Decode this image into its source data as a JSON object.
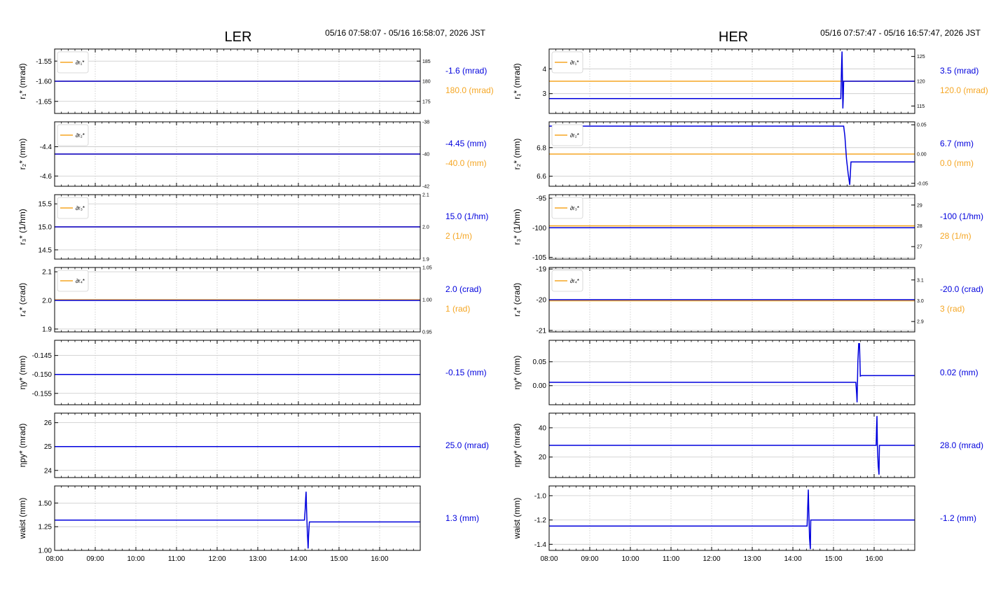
{
  "colors": {
    "current": "#0000dd",
    "target": "#f5a623",
    "grid": "#c8c8c8"
  },
  "chart_data": [
    {
      "type": "line",
      "title": "LER",
      "time_range": "05/16 07:58:07 - 05/16 16:58:07, 2026 JST",
      "x_ticks": [
        "08:00",
        "09:00",
        "10:00",
        "11:00",
        "12:00",
        "13:00",
        "14:00",
        "15:00",
        "16:00"
      ],
      "x_range_hours": [
        8.0,
        17.0
      ],
      "panels": [
        {
          "ylabel": "r₁* (mrad)",
          "ylim": [
            -1.68,
            -1.52
          ],
          "yticks": [
            "-1.55",
            "-1.60",
            "-1.65"
          ],
          "ytick_vals": [
            -1.55,
            -1.6,
            -1.65
          ],
          "y2lim": [
            172,
            188
          ],
          "y2ticks": [
            "185",
            "180",
            "175"
          ],
          "y2tick_vals": [
            185,
            180,
            175
          ],
          "legend": "∂r₁*",
          "current_label": "-1.6 (mrad)",
          "target_label": "180.0 (mrad)",
          "series": [
            {
              "name": "∂r₁*",
              "axis": "right",
              "color": "target",
              "x": [
                8.0,
                17.0
              ],
              "y": [
                180,
                180
              ]
            },
            {
              "axis": "left",
              "color": "current",
              "x": [
                8.0,
                17.0
              ],
              "y": [
                -1.6,
                -1.6
              ]
            }
          ]
        },
        {
          "ylabel": "r₂* (mm)",
          "ylim": [
            -4.67,
            -4.23
          ],
          "yticks": [
            "-4.4",
            "-4.6"
          ],
          "ytick_vals": [
            -4.4,
            -4.6
          ],
          "y2lim": [
            -42,
            -38
          ],
          "y2ticks": [
            "-38",
            "-40",
            "-42"
          ],
          "y2tick_vals": [
            -38,
            -40,
            -42
          ],
          "legend": "∂r₂*",
          "current_label": "-4.45 (mm)",
          "target_label": "-40.0 (mm)",
          "series": [
            {
              "name": "∂r₂*",
              "axis": "right",
              "color": "target",
              "x": [
                8.0,
                17.0
              ],
              "y": [
                -40,
                -40
              ]
            },
            {
              "axis": "left",
              "color": "current",
              "x": [
                8.0,
                17.0
              ],
              "y": [
                -4.45,
                -4.45
              ]
            }
          ]
        },
        {
          "ylabel": "r₃* (1/hm)",
          "ylim": [
            14.3,
            15.7
          ],
          "yticks": [
            "15.5",
            "15.0",
            "14.5"
          ],
          "ytick_vals": [
            15.5,
            15.0,
            14.5
          ],
          "y2lim": [
            1.9,
            2.1
          ],
          "y2ticks": [
            "2.1",
            "2.0",
            "1.9"
          ],
          "y2tick_vals": [
            2.1,
            2.0,
            1.9
          ],
          "legend": "∂r₃*",
          "current_label": "15.0 (1/hm)",
          "target_label": "2 (1/m)",
          "series": [
            {
              "name": "∂r₃*",
              "axis": "right",
              "color": "target",
              "x": [
                8.0,
                17.0
              ],
              "y": [
                2.0,
                2.0
              ]
            },
            {
              "axis": "left",
              "color": "current",
              "x": [
                8.0,
                17.0
              ],
              "y": [
                15.0,
                15.0
              ]
            }
          ]
        },
        {
          "ylabel": "r₄* (crad)",
          "ylim": [
            1.89,
            2.115
          ],
          "yticks": [
            "2.1",
            "2.0",
            "1.9"
          ],
          "ytick_vals": [
            2.1,
            2.0,
            1.9
          ],
          "y2lim": [
            0.95,
            1.05
          ],
          "y2ticks": [
            "1.05",
            "1.00",
            "0.95"
          ],
          "y2tick_vals": [
            1.05,
            1.0,
            0.95
          ],
          "legend": "∂r₄*",
          "current_label": "2.0 (crad)",
          "target_label": "1 (rad)",
          "series": [
            {
              "name": "∂r₄*",
              "axis": "right",
              "color": "target",
              "x": [
                8.0,
                17.0
              ],
              "y": [
                1.0,
                1.0
              ]
            },
            {
              "axis": "left",
              "color": "current",
              "x": [
                8.0,
                17.0
              ],
              "y": [
                2.0,
                2.0
              ]
            }
          ]
        },
        {
          "ylabel": "ηy* (mm)",
          "ylim": [
            -0.158,
            -0.141
          ],
          "yticks": [
            "-0.145",
            "-0.150",
            "-0.155"
          ],
          "ytick_vals": [
            -0.145,
            -0.15,
            -0.155
          ],
          "current_label": "-0.15 (mm)",
          "series": [
            {
              "axis": "left",
              "color": "current",
              "x": [
                8.0,
                17.0
              ],
              "y": [
                -0.15,
                -0.15
              ]
            }
          ]
        },
        {
          "ylabel": "ηpy* (mrad)",
          "ylim": [
            23.7,
            26.4
          ],
          "yticks": [
            "26",
            "25",
            "24"
          ],
          "ytick_vals": [
            26,
            25,
            24
          ],
          "current_label": "25.0 (mrad)",
          "series": [
            {
              "axis": "left",
              "color": "current",
              "x": [
                8.0,
                17.0
              ],
              "y": [
                25.0,
                25.0
              ]
            }
          ]
        },
        {
          "ylabel": "waist (mm)",
          "ylim": [
            1.0,
            1.68
          ],
          "yticks": [
            "1.50",
            "1.25",
            "1.00"
          ],
          "ytick_vals": [
            1.5,
            1.25,
            1.0
          ],
          "current_label": "1.3 (mm)",
          "series": [
            {
              "axis": "left",
              "color": "current",
              "x": [
                8.0,
                14.15,
                14.17,
                14.18,
                14.19,
                14.2,
                14.22,
                14.24,
                14.25,
                14.27,
                14.28,
                14.3,
                17.0
              ],
              "y": [
                1.32,
                1.32,
                1.45,
                1.55,
                1.62,
                1.45,
                1.2,
                1.02,
                1.15,
                1.3,
                1.3,
                1.3,
                1.3
              ]
            }
          ]
        }
      ]
    },
    {
      "type": "line",
      "title": "HER",
      "time_range": "05/16 07:57:47 - 05/16 16:57:47, 2026 JST",
      "x_ticks": [
        "08:00",
        "09:00",
        "10:00",
        "11:00",
        "12:00",
        "13:00",
        "14:00",
        "15:00",
        "16:00"
      ],
      "x_range_hours": [
        8.0,
        17.0
      ],
      "panels": [
        {
          "ylabel": "r₁* (mrad)",
          "ylim": [
            2.2,
            4.8
          ],
          "yticks": [
            "4",
            "3"
          ],
          "ytick_vals": [
            4,
            3
          ],
          "y2lim": [
            113.5,
            126.5
          ],
          "y2ticks": [
            "125",
            "120",
            "115"
          ],
          "y2tick_vals": [
            125,
            120,
            115
          ],
          "legend": "∂r₁*",
          "current_label": "3.5 (mrad)",
          "target_label": "120.0 (mrad)",
          "series": [
            {
              "name": "∂r₁*",
              "axis": "right",
              "color": "target",
              "x": [
                8.0,
                17.0
              ],
              "y": [
                120,
                120
              ]
            },
            {
              "axis": "left",
              "color": "current",
              "x": [
                8.0,
                15.18,
                15.19,
                15.2,
                15.21,
                15.22,
                15.23,
                15.24,
                15.25,
                15.26,
                17.0
              ],
              "y": [
                2.8,
                2.8,
                3.5,
                4.2,
                4.7,
                3.6,
                2.4,
                2.8,
                3.5,
                3.5,
                3.5
              ]
            }
          ]
        },
        {
          "ylabel": "r₂* (mm)",
          "ylim": [
            6.53,
            6.98
          ],
          "yticks": [
            "6.8",
            "6.6"
          ],
          "ytick_vals": [
            6.8,
            6.6
          ],
          "y2lim": [
            -0.055,
            0.055
          ],
          "y2ticks": [
            "0.05",
            "0.00",
            "-0.05"
          ],
          "y2tick_vals": [
            0.05,
            0.0,
            -0.05
          ],
          "legend": "∂r₂*",
          "current_label": "6.7 (mm)",
          "target_label": "0.0 (mm)",
          "series": [
            {
              "name": "∂r₂*",
              "axis": "right",
              "color": "target",
              "x": [
                8.0,
                17.0
              ],
              "y": [
                0,
                0
              ]
            },
            {
              "axis": "left",
              "color": "current",
              "x": [
                8.0,
                15.25,
                15.28,
                15.32,
                15.36,
                15.4,
                15.43,
                15.45,
                17.0
              ],
              "y": [
                6.95,
                6.95,
                6.88,
                6.72,
                6.62,
                6.54,
                6.7,
                6.7,
                6.7
              ]
            }
          ]
        },
        {
          "ylabel": "r₃* (1/hm)",
          "ylim": [
            -105.3,
            -94.4
          ],
          "yticks": [
            "-95",
            "-100",
            "-105"
          ],
          "ytick_vals": [
            -95,
            -100,
            -105
          ],
          "y2lim": [
            26.4,
            29.5
          ],
          "y2ticks": [
            "29",
            "28",
            "27"
          ],
          "y2tick_vals": [
            29,
            28,
            27
          ],
          "legend": "∂r₃*",
          "current_label": "-100 (1/hm)",
          "target_label": "28 (1/m)",
          "series": [
            {
              "name": "∂r₃*",
              "axis": "right",
              "color": "target",
              "x": [
                8.0,
                17.0
              ],
              "y": [
                28,
                28
              ]
            },
            {
              "axis": "left",
              "color": "current",
              "x": [
                8.0,
                17.0
              ],
              "y": [
                -100,
                -100
              ]
            }
          ]
        },
        {
          "ylabel": "r₄* (crad)",
          "ylim": [
            -21.05,
            -18.95
          ],
          "yticks": [
            "-19",
            "-20",
            "-21"
          ],
          "ytick_vals": [
            -19,
            -20,
            -21
          ],
          "y2lim": [
            2.85,
            3.16
          ],
          "y2ticks": [
            "3.1",
            "3.0",
            "2.9"
          ],
          "y2tick_vals": [
            3.1,
            3.0,
            2.9
          ],
          "legend": "∂r₄*",
          "current_label": "-20.0 (crad)",
          "target_label": "3 (rad)",
          "series": [
            {
              "name": "∂r₄*",
              "axis": "right",
              "color": "target",
              "x": [
                8.0,
                17.0
              ],
              "y": [
                3,
                3
              ]
            },
            {
              "axis": "left",
              "color": "current",
              "x": [
                8.0,
                17.0
              ],
              "y": [
                -20,
                -20
              ]
            }
          ]
        },
        {
          "ylabel": "ηy* (mm)",
          "ylim": [
            -0.04,
            0.095
          ],
          "yticks": [
            "0.05",
            "0.00"
          ],
          "ytick_vals": [
            0.05,
            0.0
          ],
          "current_label": "0.02 (mm)",
          "series": [
            {
              "axis": "left",
              "color": "current",
              "x": [
                8.0,
                15.55,
                15.57,
                15.58,
                15.6,
                15.62,
                15.64,
                15.66,
                15.68,
                15.7,
                17.0
              ],
              "y": [
                0.007,
                0.007,
                -0.018,
                -0.035,
                0.05,
                0.088,
                0.088,
                0.02,
                0.021,
                0.021,
                0.021
              ]
            }
          ]
        },
        {
          "ylabel": "ηpy* (mrad)",
          "ylim": [
            6,
            50
          ],
          "yticks": [
            "40",
            "20"
          ],
          "ytick_vals": [
            40,
            20
          ],
          "current_label": "28.0 (mrad)",
          "series": [
            {
              "axis": "left",
              "color": "current",
              "x": [
                8.0,
                16.05,
                16.06,
                16.07,
                16.08,
                16.1,
                16.12,
                16.13,
                16.15,
                17.0
              ],
              "y": [
                28,
                28,
                40,
                48,
                28,
                14,
                8,
                28,
                28,
                28
              ]
            }
          ]
        },
        {
          "ylabel": "waist (mm)",
          "ylim": [
            -1.45,
            -0.92
          ],
          "yticks": [
            "-1.0",
            "-1.2",
            "-1.4"
          ],
          "ytick_vals": [
            -1.0,
            -1.2,
            -1.4
          ],
          "current_label": "-1.2 (mm)",
          "series": [
            {
              "axis": "left",
              "color": "current",
              "x": [
                8.0,
                14.35,
                14.36,
                14.37,
                14.38,
                14.39,
                14.41,
                14.43,
                14.44,
                14.46,
                17.0
              ],
              "y": [
                -1.25,
                -1.25,
                -1.15,
                -1.05,
                -0.95,
                -1.1,
                -1.35,
                -1.44,
                -1.2,
                -1.2,
                -1.2
              ]
            }
          ]
        }
      ]
    }
  ]
}
